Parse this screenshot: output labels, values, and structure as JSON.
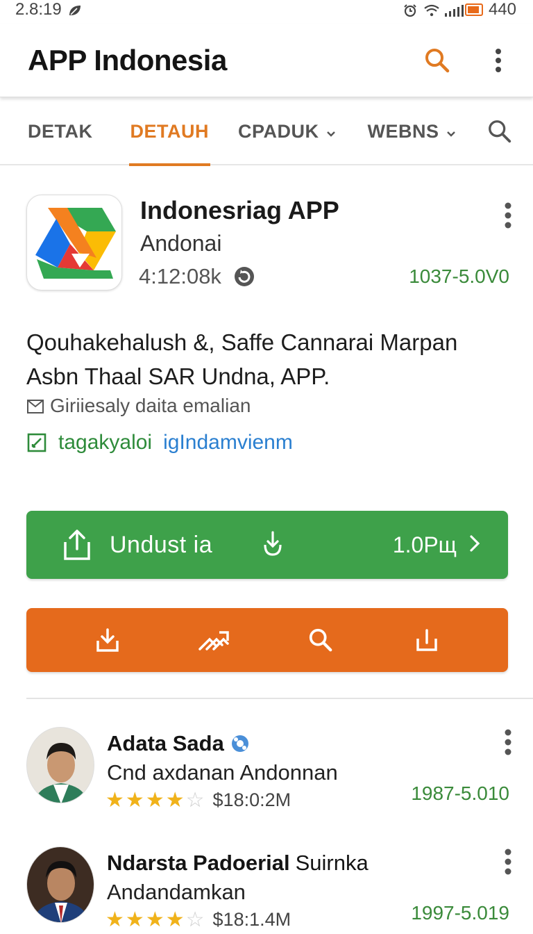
{
  "status_bar": {
    "time": "2.8:19",
    "battery_text": "440"
  },
  "app_bar": {
    "title": "APP Indonesia"
  },
  "tabs": [
    {
      "label": "DETAK",
      "active": false
    },
    {
      "label": "DETAUH",
      "active": true
    },
    {
      "label": "CPADUK",
      "active": false
    },
    {
      "label": "WEBNS",
      "active": false
    }
  ],
  "app": {
    "name": "Indonesriag APP",
    "developer": "Andonai",
    "meta": "4:12:08k",
    "version": "1037-5.0V0"
  },
  "description": {
    "text": "Qouhakehalush &, Saffe Cannarai Marpan Asbn Thaal SAR Undna, APP.",
    "line1": "Giriiesaly daita emalian",
    "line2_green": "tagakyaloi",
    "line2_blue": "igIndamvienm"
  },
  "actions": {
    "install_label": "Undust ia",
    "install_size": "1.0Pщ"
  },
  "colors": {
    "accent_orange": "#e07a22",
    "install_green": "#3ea14a",
    "toolbar_orange": "#e56a1c",
    "version_green": "#3a8a3a"
  },
  "reviews": [
    {
      "name": "Adata Sada",
      "name_suffix": "",
      "subtitle": "Cnd axdanan Andonnan",
      "rating": 4.5,
      "amount": "$18:0:2M",
      "version": "1987-5.010"
    },
    {
      "name": "Ndarsta Padoerial",
      "name_suffix": "Suirnka",
      "subtitle": "Andandamkan",
      "rating": 4.5,
      "amount": "$18:1.4M",
      "version": "1997-5.019"
    }
  ]
}
